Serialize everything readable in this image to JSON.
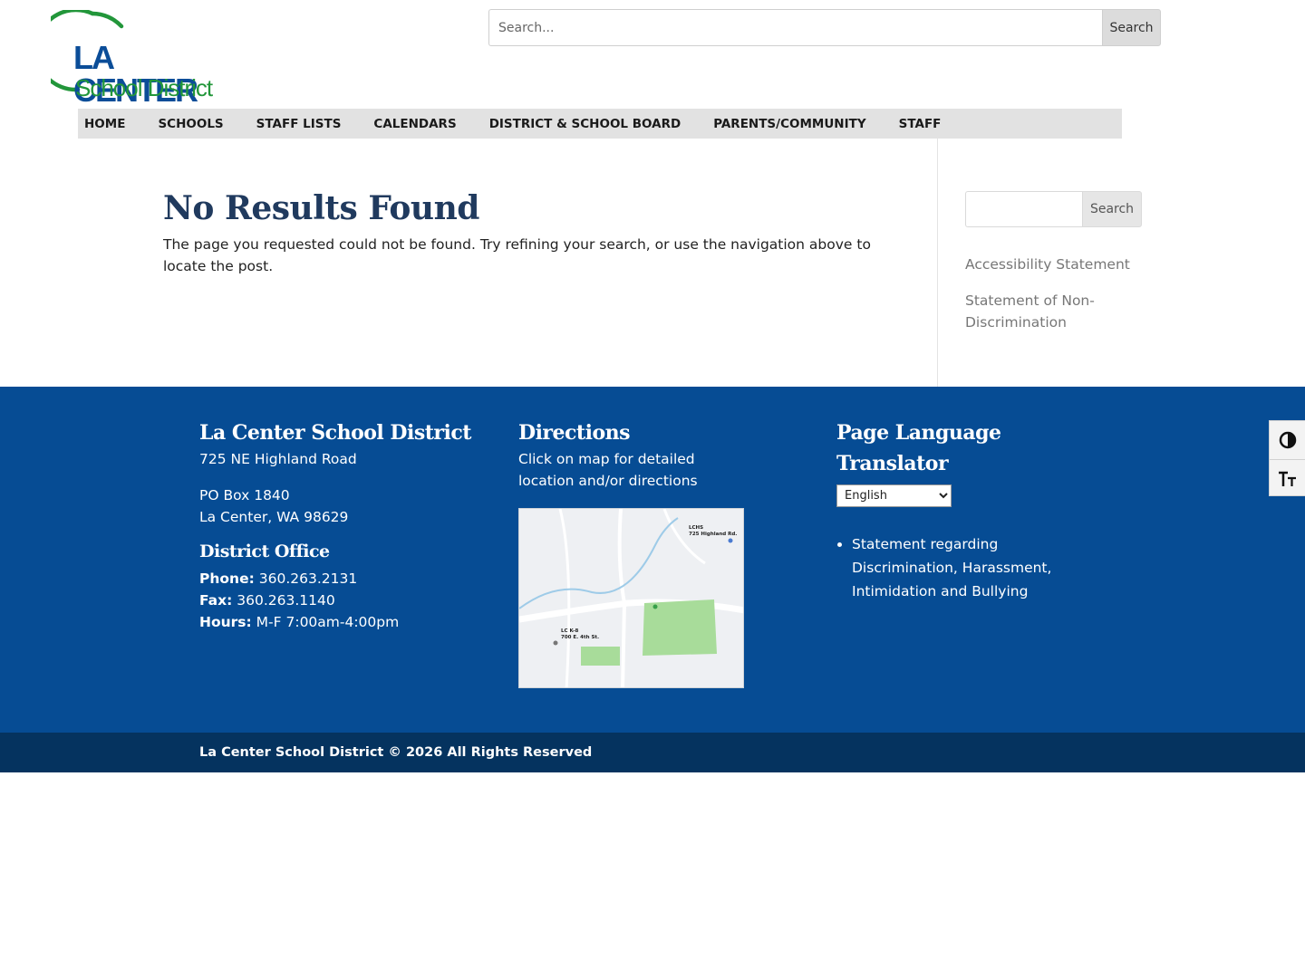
{
  "logo": {
    "line1": "LA CENTER",
    "line2": "School District"
  },
  "top_search": {
    "placeholder": "Search...",
    "button_label": "Search"
  },
  "nav": {
    "items": [
      "HOME",
      "SCHOOLS",
      "STAFF LISTS",
      "CALENDARS",
      "DISTRICT & SCHOOL BOARD",
      "PARENTS/COMMUNITY",
      "STAFF"
    ]
  },
  "main": {
    "title": "No Results Found",
    "message": "The page you requested could not be found. Try refining your search, or use the navigation above to locate the post."
  },
  "sidebar": {
    "search_button_label": "Search",
    "links": [
      "Accessibility Statement",
      "Statement of Non-Discrimination"
    ]
  },
  "footer": {
    "district": {
      "title": "La Center School District",
      "address": "725 NE Highland Road",
      "po_box": "PO Box 1840",
      "city_state_zip": "La Center, WA 98629",
      "office_title": "District Office",
      "phone_label": "Phone:",
      "phone": "360.263.2131",
      "fax_label": "Fax:",
      "fax": "360.263.1140",
      "hours_label": "Hours:",
      "hours": "M-F 7:00am-4:00pm"
    },
    "directions": {
      "title": "Directions",
      "text": "Click on map for detailed location and/or directions",
      "map_labels": {
        "lchs": "LCHS",
        "lchs_addr": "725 Highland Rd.",
        "lck8": "LC K-8",
        "lck8_addr": "700 E. 4th St."
      }
    },
    "translator": {
      "title": "Page Language Translator",
      "selected_language": "English",
      "links": [
        "Statement regarding Discrimination, Harassment, Intimidation and Bullying"
      ]
    },
    "copyright": "La Center School District © 2026 All Rights Reserved"
  },
  "accessibility_toolbar": {
    "contrast_icon": "contrast-icon",
    "font_size_icon": "font-size-icon"
  },
  "colors": {
    "footer_bg": "#064c94",
    "bottom_bar_bg": "#05335f",
    "heading": "#203a5e",
    "logo_blue": "#0b4d98",
    "logo_green": "#22963a"
  }
}
